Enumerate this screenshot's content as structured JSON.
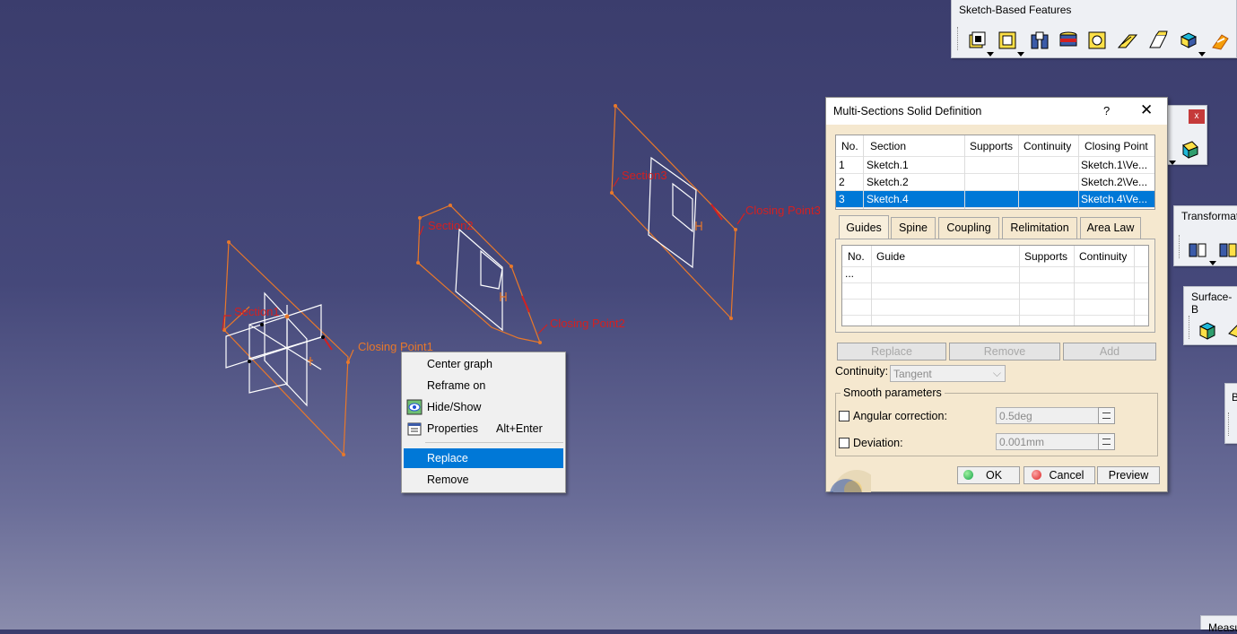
{
  "viewport": {
    "section_labels": [
      "Section1",
      "Section2",
      "Section3"
    ],
    "closing_labels": [
      "Closing Point1",
      "Closing Point2",
      "Closing Point3"
    ]
  },
  "toolbars": {
    "sketch_based": {
      "title": "Sketch-Based Features"
    },
    "transformation": {
      "title": "Transformat"
    },
    "surface_based": {
      "title": "Surface-B"
    },
    "small_close": "x",
    "partial_b": "B",
    "measure": "Measu"
  },
  "context_menu": {
    "items": [
      {
        "label": "Center graph",
        "accel": ""
      },
      {
        "label": "Reframe on",
        "accel": ""
      },
      {
        "label": "Hide/Show",
        "accel": ""
      },
      {
        "label": "Properties",
        "accel": "Alt+Enter"
      },
      {
        "label": "Replace",
        "accel": ""
      },
      {
        "label": "Remove",
        "accel": ""
      }
    ],
    "selected": "Replace"
  },
  "dialog": {
    "title": "Multi-Sections Solid Definition",
    "help": "?",
    "close": "✕",
    "sections_table": {
      "headers": [
        "No.",
        "Section",
        "Supports",
        "Continuity",
        "Closing Point"
      ],
      "rows": [
        {
          "no": "1",
          "section": "Sketch.1",
          "supports": "",
          "continuity": "",
          "closing": "Sketch.1\\Ve..."
        },
        {
          "no": "2",
          "section": "Sketch.2",
          "supports": "",
          "continuity": "",
          "closing": "Sketch.2\\Ve..."
        },
        {
          "no": "3",
          "section": "Sketch.4",
          "supports": "",
          "continuity": "",
          "closing": "Sketch.4\\Ve..."
        }
      ],
      "selected_row": 3
    },
    "tabs": [
      "Guides",
      "Spine",
      "Coupling",
      "Relimitation",
      "Area Law"
    ],
    "active_tab": "Guides",
    "guides_table": {
      "headers": [
        "No.",
        "Guide",
        "Supports",
        "Continuity"
      ],
      "rows": [
        {
          "no": "...",
          "guide": "",
          "supports": "",
          "continuity": ""
        }
      ]
    },
    "buttons_row": [
      "Replace",
      "Remove",
      "Add"
    ],
    "continuity_label": "Continuity:",
    "continuity_value": "Tangent",
    "smooth_group": "Smooth parameters",
    "angular_label": "Angular correction:",
    "angular_value": "0.5deg",
    "deviation_label": "Deviation:",
    "deviation_value": "0.001mm",
    "ok": "OK",
    "cancel": "Cancel",
    "preview": "Preview"
  },
  "colors": {
    "accent": "#0078d7",
    "curve_orange": "#e8782a",
    "label_red": "#d42020",
    "label_orange": "#e8782a",
    "dialog_bg": "#f5e8cf"
  }
}
